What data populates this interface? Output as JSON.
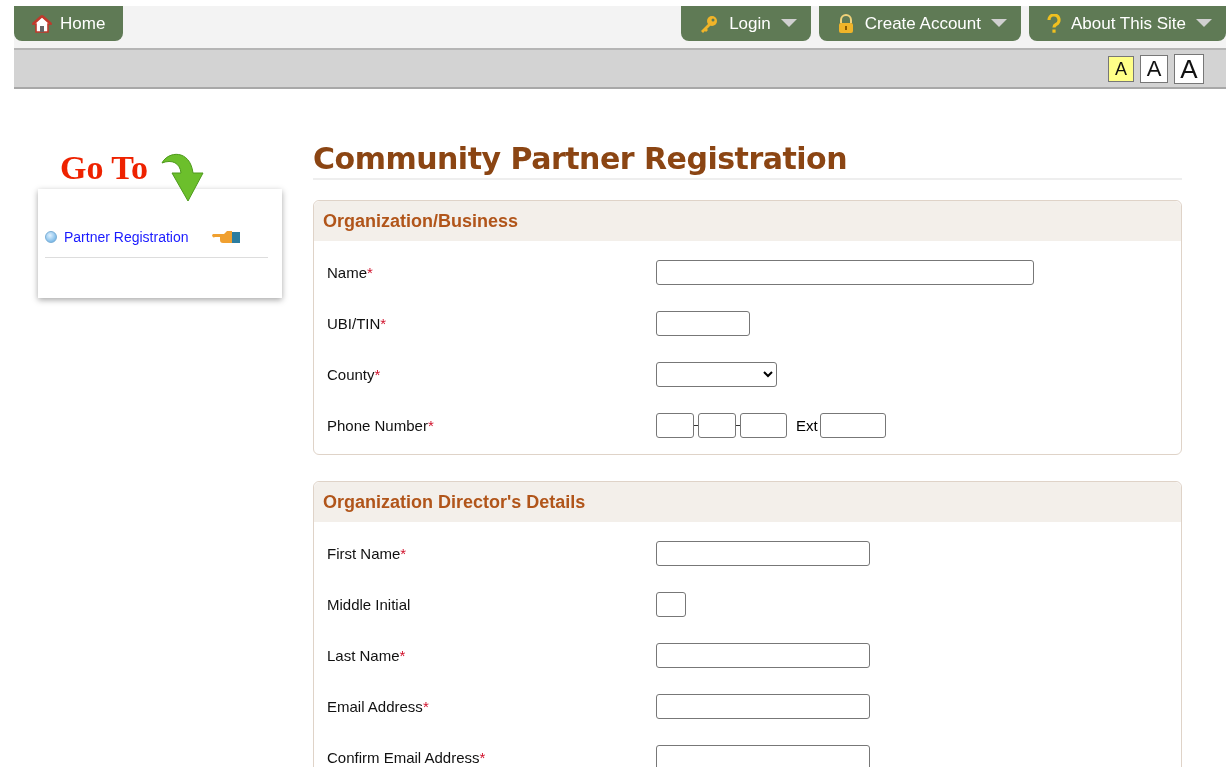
{
  "nav": {
    "home": "Home",
    "menus": [
      {
        "kind": "key",
        "label": "Login"
      },
      {
        "kind": "lock",
        "label": "Create Account"
      },
      {
        "kind": "help",
        "label": "About This Site"
      }
    ]
  },
  "font_sizes": [
    {
      "label": "A",
      "selected": true
    },
    {
      "label": "A",
      "selected": false
    },
    {
      "label": "A",
      "selected": false
    }
  ],
  "goto": {
    "title": "Go To",
    "items": [
      {
        "label": "Partner Registration"
      }
    ]
  },
  "page_title": "Community Partner Registration",
  "sections": [
    {
      "title": "Organization/Business",
      "fields": [
        {
          "label": "Name",
          "mark": "*",
          "kind": "wide"
        },
        {
          "label": "UBI/TIN",
          "mark": "*",
          "kind": "short"
        },
        {
          "label": "County",
          "mark": "*",
          "kind": "select"
        },
        {
          "label": "Phone Number",
          "mark": "*",
          "kind": "phone",
          "ext": "Ext"
        }
      ]
    },
    {
      "title": "Organization Director's Details",
      "fields": [
        {
          "label": "First Name",
          "mark": "*",
          "kind": "medium"
        },
        {
          "label": "Middle Initial",
          "kind": "initial"
        },
        {
          "label": "Last Name",
          "mark": "*",
          "kind": "medium"
        },
        {
          "label": "Email Address",
          "mark": "*",
          "kind": "medium"
        },
        {
          "label": "Confirm Email Address",
          "mark": "*",
          "kind": "medium"
        }
      ]
    }
  ]
}
